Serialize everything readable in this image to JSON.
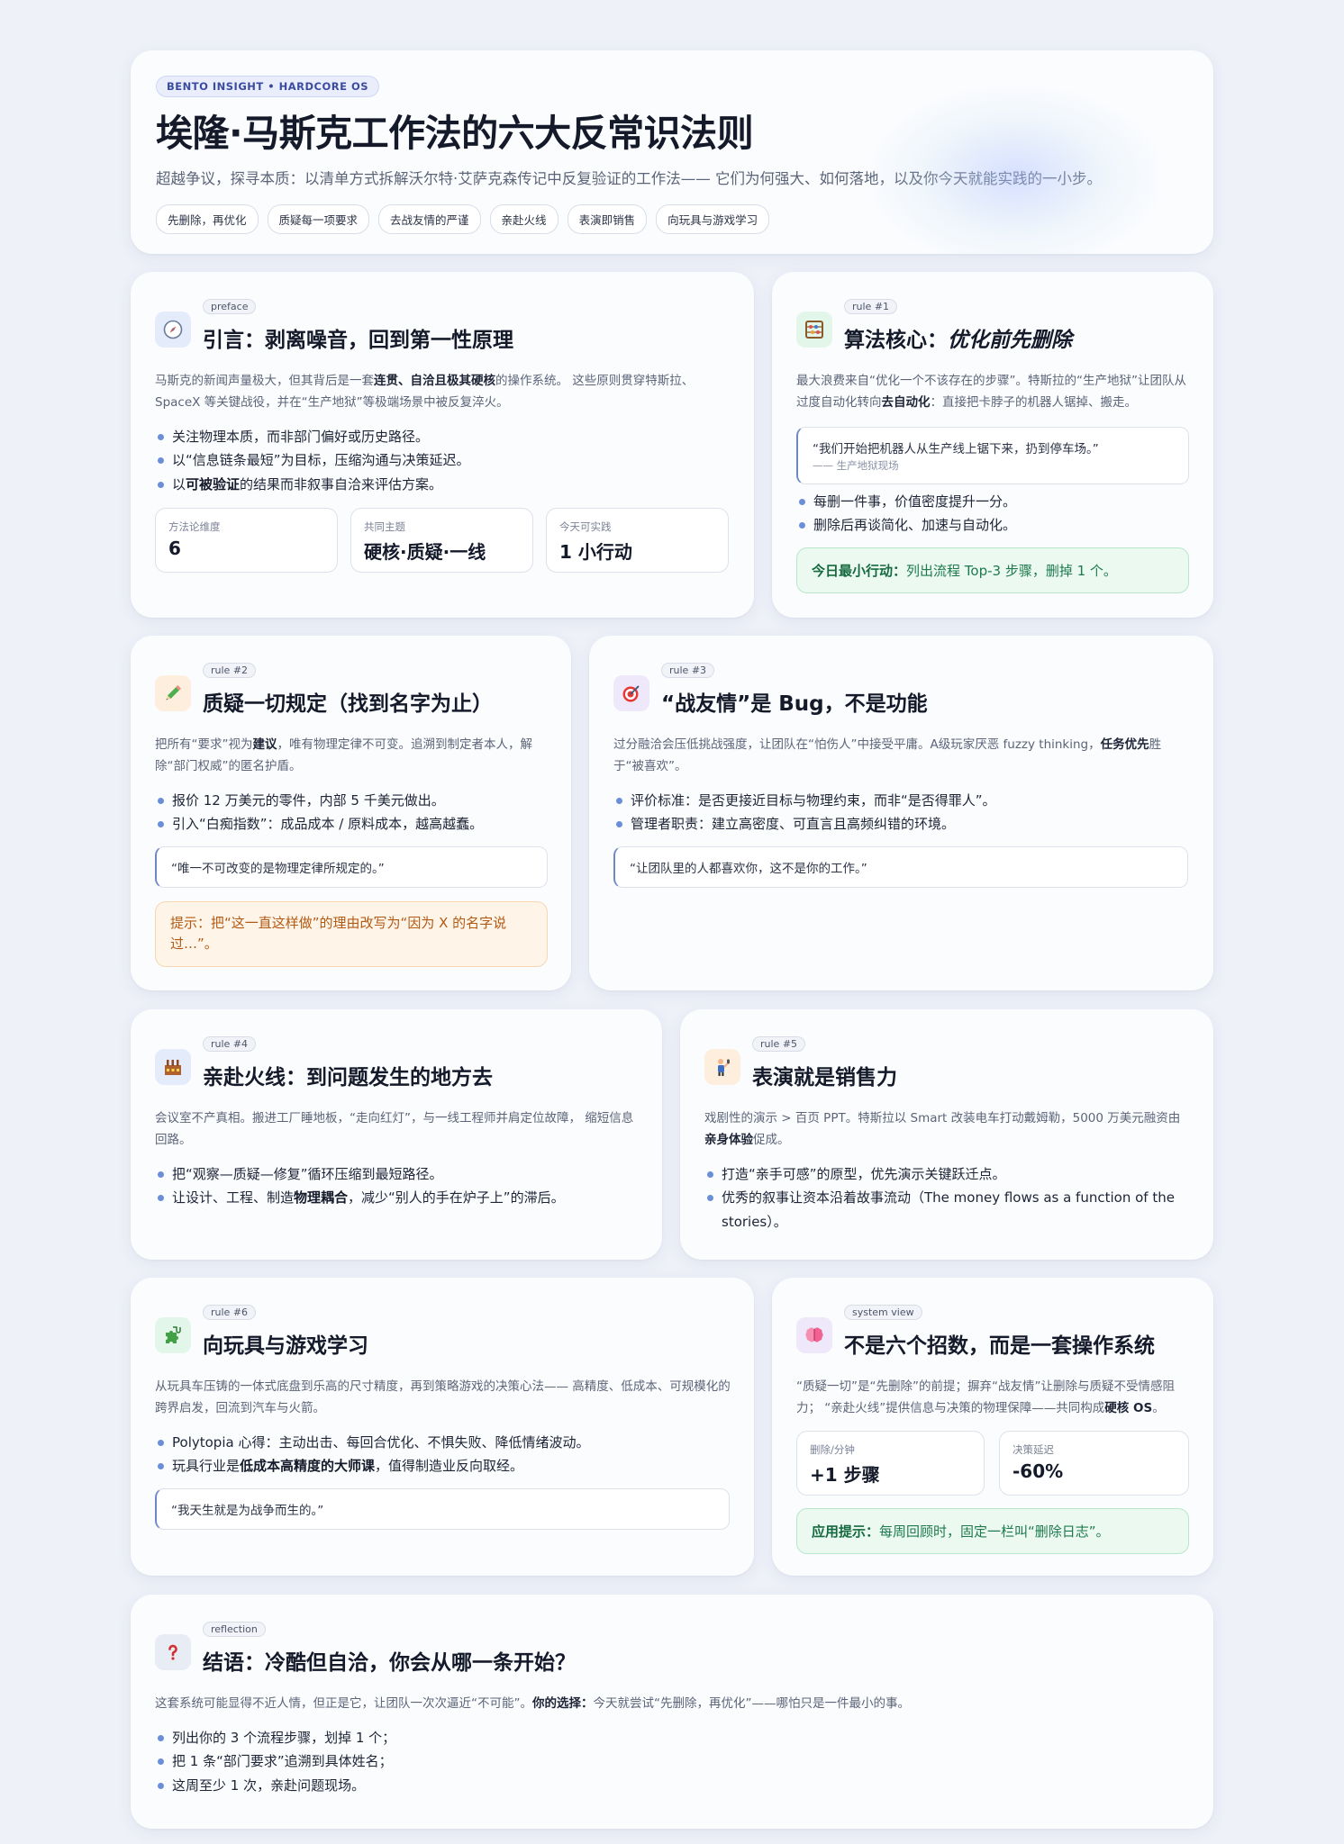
{
  "hero": {
    "badge": "BENTO INSIGHT • HARDCORE OS",
    "title": "埃隆·马斯克工作法的六大反常识法则",
    "subtitle": "超越争议，探寻本质：以清单方式拆解沃尔特·艾萨克森传记中反复验证的工作法—— 它们为何强大、如何落地，以及你今天就能实践的一小步。",
    "tags": [
      "先删除，再优化",
      "质疑每一项要求",
      "去战友情的严谨",
      "亲赴火线",
      "表演即销售",
      "向玩具与游戏学习"
    ]
  },
  "preface": {
    "pill": "preface",
    "icon": "compass-icon",
    "title": "引言：剥离噪音，回到第一性原理",
    "body_1": "马斯克的新闻声量极大，但其背后是一套",
    "body_b1": "连贯、自洽且极其硬核",
    "body_2": "的操作系统。 这些原则贯穿特斯拉、SpaceX 等关键战役，并在“生产地狱”等极端场景中被反复淬火。",
    "bullets": [
      "关注物理本质，而非部门偏好或历史路径。",
      "以“信息链条最短”为目标，压缩沟通与决策延迟。"
    ],
    "bullet3_pre": "以",
    "bullet3_b": "可被验证",
    "bullet3_post": "的结果而非叙事自洽来评估方案。",
    "stats": [
      {
        "label": "方法论维度",
        "value": "6"
      },
      {
        "label": "共同主题",
        "value": "硬核·质疑·一线"
      },
      {
        "label": "今天可实践",
        "value": "1 小行动"
      }
    ]
  },
  "rule1": {
    "pill": "rule #1",
    "icon": "abacus-icon",
    "title_pre": "算法核心：",
    "title_em": "优化前先删除",
    "body_1": "最大浪费来自“优化一个不该存在的步骤”。特斯拉的“生产地狱”让团队从 过度自动化转向",
    "body_b": "去自动化",
    "body_2": "：直接把卡脖子的机器人锯掉、搬走。",
    "quote": "“我们开始把机器人从生产线上锯下来，扔到停车场。”",
    "quote_src": "—— 生产地狱现场",
    "bullets": [
      "每删一件事，价值密度提升一分。",
      "删除后再谈简化、加速与自动化。"
    ],
    "tip_b": "今日最小行动：",
    "tip": "列出流程 Top-3 步骤，删掉 1 个。"
  },
  "rule2": {
    "pill": "rule #2",
    "icon": "pencil-icon",
    "title": "质疑一切规定（找到名字为止）",
    "body_1": "把所有“要求”视为",
    "body_b": "建议",
    "body_2": "，唯有物理定律不可变。追溯到制定者本人，解除“部门权威”的匿名护盾。",
    "bullets": [
      "报价 12 万美元的零件，内部 5 千美元做出。",
      "引入“白痴指数”：成品成本 / 原料成本，越高越蠢。"
    ],
    "quote": "“唯一不可改变的是物理定律所规定的。”",
    "tip": "提示：把“这一直这样做”的理由改写为“因为 X 的名字说过…”。"
  },
  "rule3": {
    "pill": "rule #3",
    "icon": "target-icon",
    "title": "“战友情”是 Bug，不是功能",
    "body_1": "过分融洽会压低挑战强度，让团队在“怕伤人”中接受平庸。A级玩家厌恶 fuzzy thinking，",
    "body_b": "任务优先",
    "body_2": "胜于“被喜欢”。",
    "bullets": [
      "评价标准：是否更接近目标与物理约束，而非“是否得罪人”。",
      "管理者职责：建立高密度、可直言且高频纠错的环境。"
    ],
    "quote": "“让团队里的人都喜欢你，这不是你的工作。”"
  },
  "rule4": {
    "pill": "rule #4",
    "icon": "factory-icon",
    "title": "亲赴火线：到问题发生的地方去",
    "body": "会议室不产真相。搬进工厂睡地板，“走向红灯”，与一线工程师并肩定位故障， 缩短信息回路。",
    "bullet1": "把“观察—质疑—修复”循环压缩到最短路径。",
    "bullet2_pre": "让设计、工程、制造",
    "bullet2_b": "物理耦合",
    "bullet2_post": "，减少“别人的手在炉子上”的滞后。"
  },
  "rule5": {
    "pill": "rule #5",
    "icon": "performer-icon",
    "title": "表演就是销售力",
    "body_1": "戏剧性的演示 > 百页 PPT。特斯拉以 Smart 改装电车打动戴姆勒，5000 万美元融资由",
    "body_b": "亲身体验",
    "body_2": "促成。",
    "bullets": [
      "打造“亲手可感”的原型，优先演示关键跃迁点。",
      "优秀的叙事让资本沿着故事流动（The money flows as a function of the stories）。"
    ]
  },
  "rule6": {
    "pill": "rule #6",
    "icon": "puzzle-icon",
    "title": "向玩具与游戏学习",
    "body": "从玩具车压铸的一体式底盘到乐高的尺寸精度，再到策略游戏的决策心法—— 高精度、低成本、可规模化的跨界启发，回流到汽车与火箭。",
    "bullet1": "Polytopia 心得：主动出击、每回合优化、不惧失败、降低情绪波动。",
    "bullet2_pre": "玩具行业是",
    "bullet2_b": "低成本高精度的大师课",
    "bullet2_post": "，值得制造业反向取经。",
    "quote": "“我天生就是为战争而生的。”"
  },
  "system": {
    "pill": "system view",
    "icon": "brain-icon",
    "title": "不是六个招数，而是一套操作系统",
    "body_1": "“质疑一切”是“先删除”的前提；摒弃“战友情”让删除与质疑不受情感阻力； “亲赴火线”提供信息与决策的物理保障——共同构成",
    "body_b": "硬核 OS",
    "body_2": "。",
    "stats": [
      {
        "label": "删除/分钟",
        "value": "+1 步骤"
      },
      {
        "label": "决策延迟",
        "value": "-60%"
      }
    ],
    "tip_b": "应用提示：",
    "tip": "每周回顾时，固定一栏叫“删除日志”。"
  },
  "reflection": {
    "pill": "reflection",
    "icon": "question-icon",
    "title": "结语：冷酷但自洽，你会从哪一条开始？",
    "body_1": "这套系统可能显得不近人情，但正是它，让团队一次次逼近“不可能”。",
    "body_b": "你的选择：",
    "body_2": "今天就尝试“先删除，再优化”——哪怕只是一件最小的事。",
    "bullets": [
      "列出你的 3 个流程步骤，划掉 1 个；",
      "把 1 条“部门要求”追溯到具体姓名；",
      "这周至少 1 次，亲赴问题现场。"
    ]
  }
}
